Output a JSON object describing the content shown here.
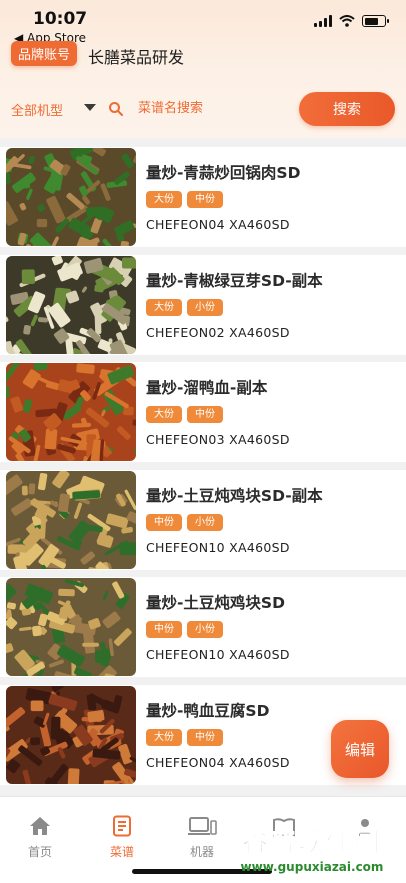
{
  "status_bar": {
    "time": "10:07",
    "back_label": "◀ App Store",
    "battery_level": 0.7
  },
  "header": {
    "brand_badge": "品牌账号",
    "title": "长膳菜品研发",
    "filter_type": "全部机型",
    "search_placeholder": "菜谱名搜索",
    "search_button": "搜索"
  },
  "recipes": [
    {
      "name": "量炒-青蒜炒回锅肉SD",
      "tags": [
        "大份",
        "中份"
      ],
      "model": "CHEFEON04 XA460SD"
    },
    {
      "name": "量炒-青椒绿豆芽SD-副本",
      "tags": [
        "大份",
        "小份"
      ],
      "model": "CHEFEON02 XA460SD"
    },
    {
      "name": "量炒-溜鸭血-副本",
      "tags": [
        "大份",
        "中份"
      ],
      "model": "CHEFEON03 XA460SD"
    },
    {
      "name": "量炒-土豆炖鸡块SD-副本",
      "tags": [
        "中份",
        "小份"
      ],
      "model": "CHEFEON10 XA460SD"
    },
    {
      "name": "量炒-土豆炖鸡块SD",
      "tags": [
        "中份",
        "小份"
      ],
      "model": "CHEFEON10 XA460SD"
    },
    {
      "name": "量炒-鸭血豆腐SD",
      "tags": [
        "大份",
        "中份"
      ],
      "model": "CHEFEON04 XA460SD"
    }
  ],
  "edit_button": "编辑",
  "tabs": [
    {
      "label": "首页",
      "icon": "home-icon"
    },
    {
      "label": "菜谱",
      "icon": "recipe-icon"
    },
    {
      "label": "机器",
      "icon": "machine-icon"
    }
  ],
  "watermark": {
    "title": "谷普软件园",
    "url": "www.gupuxiazai.com"
  },
  "colors": {
    "accent": "#ee6b34",
    "tag": "#ee8a3a",
    "inactive": "#8a8a8a"
  }
}
